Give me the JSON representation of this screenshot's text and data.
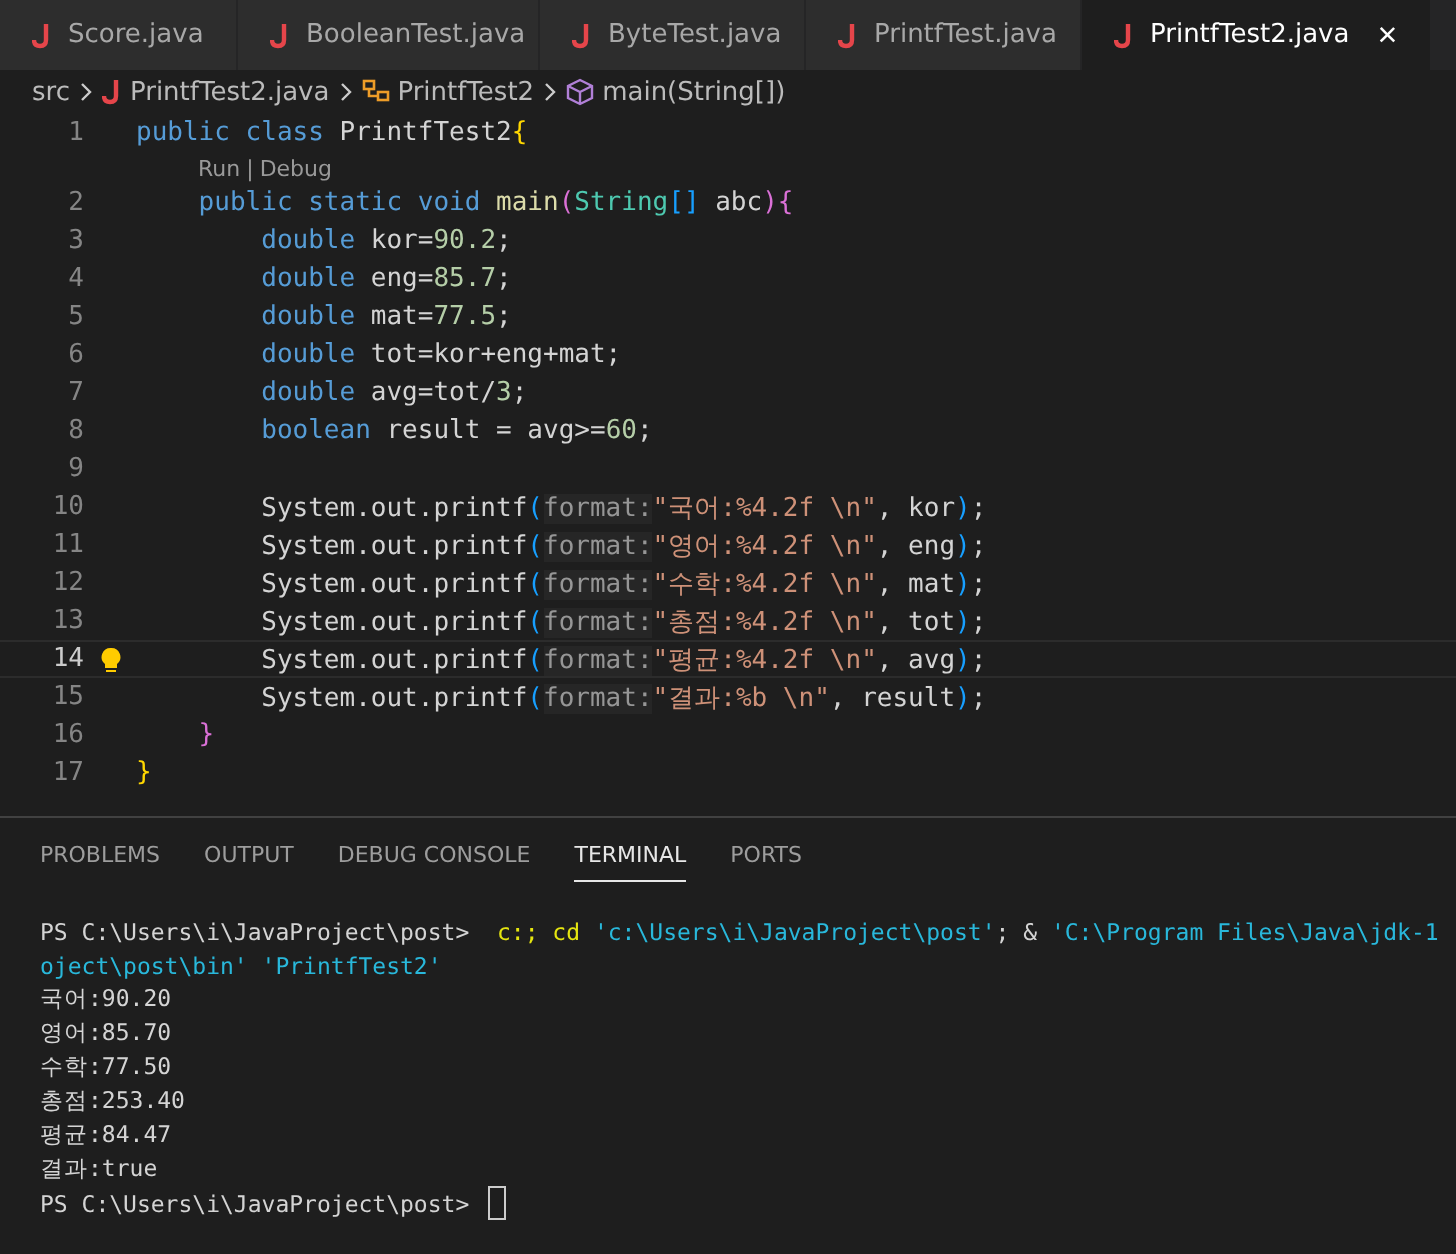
{
  "tabs": [
    {
      "label": "Score.java",
      "selected": false
    },
    {
      "label": "BooleanTest.java",
      "selected": false
    },
    {
      "label": "ByteTest.java",
      "selected": false
    },
    {
      "label": "PrintfTest.java",
      "selected": false
    },
    {
      "label": "PrintfTest2.java",
      "selected": true,
      "close": "×"
    }
  ],
  "breadcrumb": [
    {
      "kind": "folder",
      "label": "src"
    },
    {
      "kind": "file",
      "label": "PrintfTest2.java"
    },
    {
      "kind": "class",
      "label": "PrintfTest2"
    },
    {
      "kind": "method",
      "label": "main(String[])"
    }
  ],
  "editor_lines": [
    {
      "number": "1",
      "current": false,
      "tokens": [
        {
          "t": "public class ",
          "kind": "kw"
        },
        {
          "t": "PrintfTest2",
          "kind": "plain"
        },
        {
          "t": "{",
          "kind": "b1"
        }
      ],
      "codelens": {
        "items": [
          "Run",
          "Debug"
        ],
        "separator": "|"
      }
    },
    {
      "number": "2",
      "current": false,
      "tokens": [
        {
          "t": "    public static void ",
          "kind": "kw"
        },
        {
          "t": "main",
          "kind": "fn"
        },
        {
          "t": "(",
          "kind": "b2"
        },
        {
          "t": "String",
          "kind": "type"
        },
        {
          "t": "[]",
          "kind": "b3"
        },
        {
          "t": " abc",
          "kind": "plain"
        },
        {
          "t": ")",
          "kind": "b2"
        },
        {
          "t": "{",
          "kind": "b2"
        }
      ]
    },
    {
      "number": "3",
      "current": false,
      "tokens": [
        {
          "t": "        double ",
          "kind": "kw"
        },
        {
          "t": "kor=",
          "kind": "plain"
        },
        {
          "t": "90.2",
          "kind": "num"
        },
        {
          "t": ";",
          "kind": "plain"
        }
      ]
    },
    {
      "number": "4",
      "current": false,
      "tokens": [
        {
          "t": "        double ",
          "kind": "kw"
        },
        {
          "t": "eng=",
          "kind": "plain"
        },
        {
          "t": "85.7",
          "kind": "num"
        },
        {
          "t": ";",
          "kind": "plain"
        }
      ]
    },
    {
      "number": "5",
      "current": false,
      "tokens": [
        {
          "t": "        double ",
          "kind": "kw"
        },
        {
          "t": "mat=",
          "kind": "plain"
        },
        {
          "t": "77.5",
          "kind": "num"
        },
        {
          "t": ";",
          "kind": "plain"
        }
      ]
    },
    {
      "number": "6",
      "current": false,
      "tokens": [
        {
          "t": "        double ",
          "kind": "kw"
        },
        {
          "t": "tot=kor+eng+mat;",
          "kind": "plain"
        }
      ]
    },
    {
      "number": "7",
      "current": false,
      "tokens": [
        {
          "t": "        double ",
          "kind": "kw"
        },
        {
          "t": "avg=tot/",
          "kind": "plain"
        },
        {
          "t": "3",
          "kind": "num"
        },
        {
          "t": ";",
          "kind": "plain"
        }
      ]
    },
    {
      "number": "8",
      "current": false,
      "tokens": [
        {
          "t": "        boolean ",
          "kind": "kw"
        },
        {
          "t": "result = avg>=",
          "kind": "plain"
        },
        {
          "t": "60",
          "kind": "num"
        },
        {
          "t": ";",
          "kind": "plain"
        }
      ]
    },
    {
      "number": "9",
      "current": false
    },
    {
      "number": "10",
      "current": false,
      "tokens": [
        {
          "t": "        System.out.printf",
          "kind": "plain"
        },
        {
          "t": "(",
          "kind": "b3"
        },
        {
          "t": "format:",
          "kind": "hint"
        },
        {
          "t": "\"국어:%4.2f \\n\"",
          "kind": "str"
        },
        {
          "t": ", kor",
          "kind": "plain"
        },
        {
          "t": ")",
          "kind": "b3"
        },
        {
          "t": ";",
          "kind": "plain"
        }
      ]
    },
    {
      "number": "11",
      "current": false,
      "tokens": [
        {
          "t": "        System.out.printf",
          "kind": "plain"
        },
        {
          "t": "(",
          "kind": "b3"
        },
        {
          "t": "format:",
          "kind": "hint"
        },
        {
          "t": "\"영어:%4.2f \\n\"",
          "kind": "str"
        },
        {
          "t": ", eng",
          "kind": "plain"
        },
        {
          "t": ")",
          "kind": "b3"
        },
        {
          "t": ";",
          "kind": "plain"
        }
      ]
    },
    {
      "number": "12",
      "current": false,
      "tokens": [
        {
          "t": "        System.out.printf",
          "kind": "plain"
        },
        {
          "t": "(",
          "kind": "b3"
        },
        {
          "t": "format:",
          "kind": "hint"
        },
        {
          "t": "\"수학:%4.2f \\n\"",
          "kind": "str"
        },
        {
          "t": ", mat",
          "kind": "plain"
        },
        {
          "t": ")",
          "kind": "b3"
        },
        {
          "t": ";",
          "kind": "plain"
        }
      ]
    },
    {
      "number": "13",
      "current": false,
      "tokens": [
        {
          "t": "        System.out.printf",
          "kind": "plain"
        },
        {
          "t": "(",
          "kind": "b3"
        },
        {
          "t": "format:",
          "kind": "hint"
        },
        {
          "t": "\"총점:%4.2f \\n\"",
          "kind": "str"
        },
        {
          "t": ", tot",
          "kind": "plain"
        },
        {
          "t": ")",
          "kind": "b3"
        },
        {
          "t": ";",
          "kind": "plain"
        }
      ]
    },
    {
      "number": "14",
      "current": true,
      "lightbulb": true,
      "tokens": [
        {
          "t": "        System.out.printf",
          "kind": "plain"
        },
        {
          "t": "(",
          "kind": "b3"
        },
        {
          "t": "format:",
          "kind": "hint"
        },
        {
          "t": "\"평균:%4.2f \\n\"",
          "kind": "str"
        },
        {
          "t": ", avg",
          "kind": "plain"
        },
        {
          "t": ")",
          "kind": "b3"
        },
        {
          "t": ";",
          "kind": "plain"
        }
      ]
    },
    {
      "number": "15",
      "current": false,
      "tokens": [
        {
          "t": "        System.out.printf",
          "kind": "plain"
        },
        {
          "t": "(",
          "kind": "b3"
        },
        {
          "t": "format:",
          "kind": "hint"
        },
        {
          "t": "\"결과:%b \\n\"",
          "kind": "str"
        },
        {
          "t": ", result",
          "kind": "plain"
        },
        {
          "t": ")",
          "kind": "b3"
        },
        {
          "t": ";",
          "kind": "plain"
        }
      ]
    },
    {
      "number": "16",
      "current": false,
      "tokens": [
        {
          "t": "    }",
          "kind": "b2"
        }
      ]
    },
    {
      "number": "17",
      "current": false,
      "tokens": [
        {
          "t": "}",
          "kind": "b1"
        }
      ]
    }
  ],
  "panel_tabs": [
    {
      "label": "PROBLEMS",
      "selected": false
    },
    {
      "label": "OUTPUT",
      "selected": false
    },
    {
      "label": "DEBUG CONSOLE",
      "selected": false
    },
    {
      "label": "TERMINAL",
      "selected": true
    },
    {
      "label": "PORTS",
      "selected": false
    }
  ],
  "terminal_lines": [
    {
      "tokens": [
        {
          "t": "PS C:\\Users\\i\\JavaProject\\post>  ",
          "kind": "plain"
        },
        {
          "t": "c:; cd ",
          "kind": "cmd"
        },
        {
          "t": "'c:\\Users\\i\\JavaProject\\post'",
          "kind": "arg"
        },
        {
          "t": "; & ",
          "kind": "plain"
        },
        {
          "t": "'C:\\Program Files\\Java\\jdk-1",
          "kind": "arg"
        }
      ]
    },
    {
      "tokens": [
        {
          "t": "oject\\post\\bin' 'PrintfTest2'",
          "kind": "arg"
        }
      ]
    },
    {
      "tokens": [
        {
          "t": "국어:90.20",
          "kind": "plain"
        }
      ]
    },
    {
      "tokens": [
        {
          "t": "영어:85.70",
          "kind": "plain"
        }
      ]
    },
    {
      "tokens": [
        {
          "t": "수학:77.50",
          "kind": "plain"
        }
      ]
    },
    {
      "tokens": [
        {
          "t": "총점:253.40",
          "kind": "plain"
        }
      ]
    },
    {
      "tokens": [
        {
          "t": "평균:84.47",
          "kind": "plain"
        }
      ]
    },
    {
      "tokens": [
        {
          "t": "결과:true",
          "kind": "plain"
        }
      ]
    },
    {
      "tokens": [
        {
          "t": "PS C:\\Users\\i\\JavaProject\\post> ",
          "kind": "plain"
        }
      ],
      "cursor": true
    }
  ]
}
